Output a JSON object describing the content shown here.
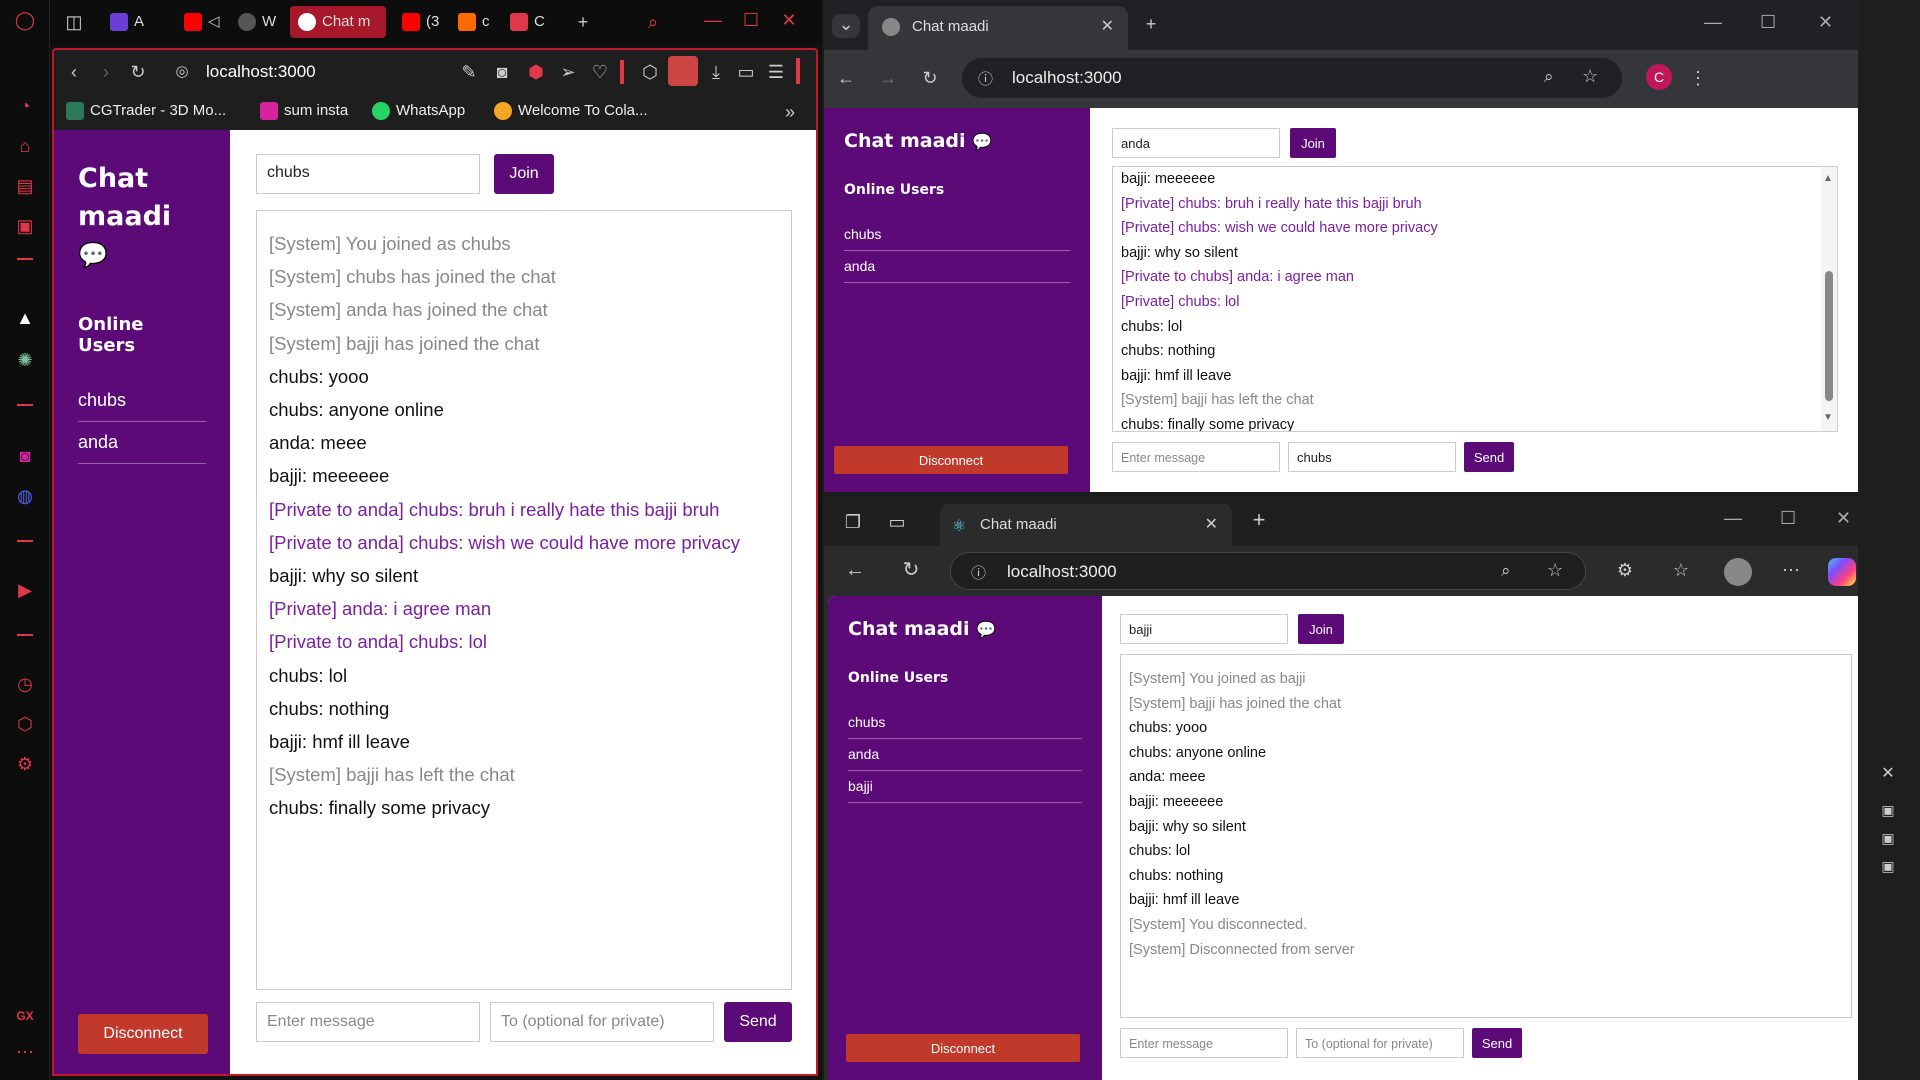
{
  "opera": {
    "tabs": [
      {
        "label": "A",
        "color": "#6b3fd6"
      },
      {
        "label": "W",
        "color": "#444"
      },
      {
        "label": "Chat m",
        "color": "#e0384b"
      },
      {
        "label": "(3",
        "color": "#ff0000"
      },
      {
        "label": "c",
        "color": "#ff6a00"
      },
      {
        "label": "C",
        "color": "#e0384b"
      }
    ],
    "address": "localhost:3000",
    "bookmarks": [
      {
        "label": "CGTrader - 3D Mo...",
        "color": "#2a7a5a"
      },
      {
        "label": "sum insta",
        "color": "#d6249f"
      },
      {
        "label": "WhatsApp",
        "color": "#25d366"
      },
      {
        "label": "Welcome To Cola...",
        "color": "#f5a623"
      }
    ],
    "rail_badge": "GX",
    "app": {
      "title_line1": "Chat",
      "title_line2": "maadi",
      "online_heading": "Online Users",
      "users": [
        "chubs",
        "anda"
      ],
      "disconnect": "Disconnect",
      "name_value": "chubs",
      "join": "Join",
      "msg_placeholder": "Enter message",
      "to_placeholder": "To (optional for private)",
      "send": "Send",
      "messages": [
        {
          "t": "[System] You joined as chubs",
          "k": "system"
        },
        {
          "t": "[System] chubs has joined the chat",
          "k": "system"
        },
        {
          "t": "[System] anda has joined the chat",
          "k": "system"
        },
        {
          "t": "[System] bajji has joined the chat",
          "k": "system"
        },
        {
          "t": "chubs: yooo",
          "k": "normal"
        },
        {
          "t": "chubs: anyone online",
          "k": "normal"
        },
        {
          "t": "anda: meee",
          "k": "normal"
        },
        {
          "t": "bajji: meeeeee",
          "k": "normal"
        },
        {
          "t": "[Private to anda] chubs: bruh i really hate this bajji bruh",
          "k": "private"
        },
        {
          "t": "[Private to anda] chubs: wish we could have more privacy",
          "k": "private"
        },
        {
          "t": "bajji: why so silent",
          "k": "normal"
        },
        {
          "t": "[Private] anda: i agree man",
          "k": "private"
        },
        {
          "t": "[Private to anda] chubs: lol",
          "k": "private"
        },
        {
          "t": "chubs: lol",
          "k": "normal"
        },
        {
          "t": "chubs: nothing",
          "k": "normal"
        },
        {
          "t": "bajji: hmf ill leave",
          "k": "normal"
        },
        {
          "t": "[System] bajji has left the chat",
          "k": "system"
        },
        {
          "t": "chubs: finally some privacy",
          "k": "normal"
        }
      ]
    }
  },
  "chrome": {
    "tab_title": "Chat maadi",
    "address": "localhost:3000",
    "profile_initial": "C",
    "app": {
      "title": "Chat maadi",
      "online_heading": "Online Users",
      "users": [
        "chubs",
        "anda"
      ],
      "disconnect": "Disconnect",
      "name_value": "anda",
      "join": "Join",
      "msg_placeholder": "Enter message",
      "to_value": "chubs",
      "send": "Send",
      "messages": [
        {
          "t": "bajji: meeeeee",
          "k": "normal"
        },
        {
          "t": "[Private] chubs: bruh i really hate this bajji bruh",
          "k": "private"
        },
        {
          "t": "[Private] chubs: wish we could have more privacy",
          "k": "private"
        },
        {
          "t": "bajji: why so silent",
          "k": "normal"
        },
        {
          "t": "[Private to chubs] anda: i agree man",
          "k": "private"
        },
        {
          "t": "[Private] chubs: lol",
          "k": "private"
        },
        {
          "t": "chubs: lol",
          "k": "normal"
        },
        {
          "t": "chubs: nothing",
          "k": "normal"
        },
        {
          "t": "bajji: hmf ill leave",
          "k": "normal"
        },
        {
          "t": "[System] bajji has left the chat",
          "k": "system"
        },
        {
          "t": "chubs: finally some privacy",
          "k": "normal"
        }
      ]
    }
  },
  "edge": {
    "tab_title": "Chat maadi",
    "address": "localhost:3000",
    "app": {
      "title": "Chat maadi",
      "online_heading": "Online Users",
      "users": [
        "chubs",
        "anda",
        "bajji"
      ],
      "disconnect": "Disconnect",
      "name_value": "bajji",
      "join": "Join",
      "msg_placeholder": "Enter message",
      "to_placeholder": "To (optional for private)",
      "send": "Send",
      "messages": [
        {
          "t": "[System] You joined as bajji",
          "k": "system"
        },
        {
          "t": "[System] bajji has joined the chat",
          "k": "system"
        },
        {
          "t": "chubs: yooo",
          "k": "normal"
        },
        {
          "t": "chubs: anyone online",
          "k": "normal"
        },
        {
          "t": "anda: meee",
          "k": "normal"
        },
        {
          "t": "bajji: meeeeee",
          "k": "normal"
        },
        {
          "t": "bajji: why so silent",
          "k": "normal"
        },
        {
          "t": "chubs: lol",
          "k": "normal"
        },
        {
          "t": "chubs: nothing",
          "k": "normal"
        },
        {
          "t": "bajji: hmf ill leave",
          "k": "normal"
        },
        {
          "t": "[System] You disconnected.",
          "k": "system"
        },
        {
          "t": "[System] Disconnected from server",
          "k": "system"
        }
      ]
    }
  }
}
